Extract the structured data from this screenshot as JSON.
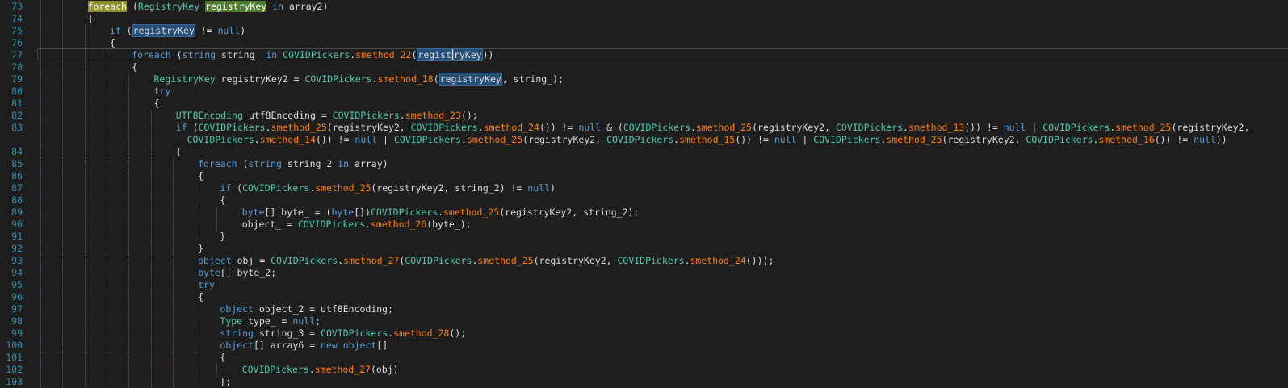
{
  "colors": {
    "background": "#1e1e1e",
    "line_number": "#2b91af",
    "keyword": "#569cd6",
    "type": "#4ec9b0",
    "method": "#ff8000",
    "text": "#dcdcdc",
    "indent_guide": "#6a4a7a"
  },
  "editor": {
    "current_line": "77",
    "lines": [
      {
        "n": "73",
        "indent": 2,
        "tokens": [
          {
            "t": "foreach",
            "c": "kw hl-yellow"
          },
          {
            "t": " (",
            "c": "tx"
          },
          {
            "t": "RegistryKey",
            "c": "ty"
          },
          {
            "t": " ",
            "c": "tx"
          },
          {
            "t": "registryKey",
            "c": "tx hl-green"
          },
          {
            "t": " ",
            "c": "tx"
          },
          {
            "t": "in",
            "c": "kw"
          },
          {
            "t": " array2)",
            "c": "tx"
          }
        ]
      },
      {
        "n": "74",
        "indent": 2,
        "tokens": [
          {
            "t": "{",
            "c": "tx"
          }
        ]
      },
      {
        "n": "75",
        "indent": 3,
        "tokens": [
          {
            "t": "if",
            "c": "kw"
          },
          {
            "t": " (",
            "c": "tx"
          },
          {
            "t": "registryKey",
            "c": "tx hl-blue"
          },
          {
            "t": " != ",
            "c": "tx"
          },
          {
            "t": "null",
            "c": "kw"
          },
          {
            "t": ")",
            "c": "tx"
          }
        ]
      },
      {
        "n": "76",
        "indent": 3,
        "tokens": [
          {
            "t": "{",
            "c": "tx"
          }
        ]
      },
      {
        "n": "77",
        "indent": 4,
        "tokens": [
          {
            "t": "foreach",
            "c": "kw"
          },
          {
            "t": " (",
            "c": "tx"
          },
          {
            "t": "string",
            "c": "kw"
          },
          {
            "t": " string_ ",
            "c": "tx"
          },
          {
            "t": "in",
            "c": "kw"
          },
          {
            "t": " ",
            "c": "tx"
          },
          {
            "t": "COVIDPickers",
            "c": "ty"
          },
          {
            "t": ".",
            "c": "tx"
          },
          {
            "t": "smethod_22",
            "c": "mt"
          },
          {
            "t": "(",
            "c": "tx"
          },
          {
            "t": "regist",
            "c": "tx hl-blue",
            "caret_after": true
          },
          {
            "t": "ryKey",
            "c": "tx hl-blue"
          },
          {
            "t": "))",
            "c": "tx"
          }
        ]
      },
      {
        "n": "78",
        "indent": 4,
        "tokens": [
          {
            "t": "{",
            "c": "tx"
          }
        ]
      },
      {
        "n": "79",
        "indent": 5,
        "tokens": [
          {
            "t": "RegistryKey",
            "c": "ty"
          },
          {
            "t": " registryKey2 = ",
            "c": "tx"
          },
          {
            "t": "COVIDPickers",
            "c": "ty"
          },
          {
            "t": ".",
            "c": "tx"
          },
          {
            "t": "smethod_18",
            "c": "mt"
          },
          {
            "t": "(",
            "c": "tx"
          },
          {
            "t": "registryKey",
            "c": "tx hl-blue"
          },
          {
            "t": ", string_);",
            "c": "tx"
          }
        ]
      },
      {
        "n": "80",
        "indent": 5,
        "tokens": [
          {
            "t": "try",
            "c": "kw"
          }
        ]
      },
      {
        "n": "81",
        "indent": 5,
        "tokens": [
          {
            "t": "{",
            "c": "tx"
          }
        ]
      },
      {
        "n": "82",
        "indent": 6,
        "tokens": [
          {
            "t": "UTF8Encoding",
            "c": "ty"
          },
          {
            "t": " utf8Encoding = ",
            "c": "tx"
          },
          {
            "t": "COVIDPickers",
            "c": "ty"
          },
          {
            "t": ".",
            "c": "tx"
          },
          {
            "t": "smethod_23",
            "c": "mt"
          },
          {
            "t": "();",
            "c": "tx"
          }
        ]
      },
      {
        "n": "83",
        "indent": 6,
        "tokens": [
          {
            "t": "if",
            "c": "kw"
          },
          {
            "t": " (",
            "c": "tx"
          },
          {
            "t": "COVIDPickers",
            "c": "ty"
          },
          {
            "t": ".",
            "c": "tx"
          },
          {
            "t": "smethod_25",
            "c": "mt"
          },
          {
            "t": "(registryKey2, ",
            "c": "tx"
          },
          {
            "t": "COVIDPickers",
            "c": "ty"
          },
          {
            "t": ".",
            "c": "tx"
          },
          {
            "t": "smethod_24",
            "c": "mt"
          },
          {
            "t": "()) != ",
            "c": "tx"
          },
          {
            "t": "null",
            "c": "kw"
          },
          {
            "t": " & (",
            "c": "tx"
          },
          {
            "t": "COVIDPickers",
            "c": "ty"
          },
          {
            "t": ".",
            "c": "tx"
          },
          {
            "t": "smethod_25",
            "c": "mt"
          },
          {
            "t": "(registryKey2, ",
            "c": "tx"
          },
          {
            "t": "COVIDPickers",
            "c": "ty"
          },
          {
            "t": ".",
            "c": "tx"
          },
          {
            "t": "smethod_13",
            "c": "mt"
          },
          {
            "t": "()) != ",
            "c": "tx"
          },
          {
            "t": "null",
            "c": "kw"
          },
          {
            "t": " | ",
            "c": "tx"
          },
          {
            "t": "COVIDPickers",
            "c": "ty"
          },
          {
            "t": ".",
            "c": "tx"
          },
          {
            "t": "smethod_25",
            "c": "mt"
          },
          {
            "t": "(registryKey2,",
            "c": "tx"
          }
        ]
      },
      {
        "n": "",
        "indent": 6,
        "wrap": true,
        "tokens": [
          {
            "t": "  ",
            "c": "tx"
          },
          {
            "t": "COVIDPickers",
            "c": "ty"
          },
          {
            "t": ".",
            "c": "tx"
          },
          {
            "t": "smethod_14",
            "c": "mt"
          },
          {
            "t": "()) != ",
            "c": "tx"
          },
          {
            "t": "null",
            "c": "kw"
          },
          {
            "t": " | ",
            "c": "tx"
          },
          {
            "t": "COVIDPickers",
            "c": "ty"
          },
          {
            "t": ".",
            "c": "tx"
          },
          {
            "t": "smethod_25",
            "c": "mt"
          },
          {
            "t": "(registryKey2, ",
            "c": "tx"
          },
          {
            "t": "COVIDPickers",
            "c": "ty"
          },
          {
            "t": ".",
            "c": "tx"
          },
          {
            "t": "smethod_15",
            "c": "mt"
          },
          {
            "t": "()) != ",
            "c": "tx"
          },
          {
            "t": "null",
            "c": "kw"
          },
          {
            "t": " | ",
            "c": "tx"
          },
          {
            "t": "COVIDPickers",
            "c": "ty"
          },
          {
            "t": ".",
            "c": "tx"
          },
          {
            "t": "smethod_25",
            "c": "mt"
          },
          {
            "t": "(registryKey2, ",
            "c": "tx"
          },
          {
            "t": "COVIDPickers",
            "c": "ty"
          },
          {
            "t": ".",
            "c": "tx"
          },
          {
            "t": "smethod_16",
            "c": "mt"
          },
          {
            "t": "()) != ",
            "c": "tx"
          },
          {
            "t": "null",
            "c": "kw"
          },
          {
            "t": "))",
            "c": "tx"
          }
        ]
      },
      {
        "n": "84",
        "indent": 6,
        "tokens": [
          {
            "t": "{",
            "c": "tx"
          }
        ]
      },
      {
        "n": "85",
        "indent": 7,
        "tokens": [
          {
            "t": "foreach",
            "c": "kw"
          },
          {
            "t": " (",
            "c": "tx"
          },
          {
            "t": "string",
            "c": "kw"
          },
          {
            "t": " string_2 ",
            "c": "tx"
          },
          {
            "t": "in",
            "c": "kw"
          },
          {
            "t": " array)",
            "c": "tx"
          }
        ]
      },
      {
        "n": "86",
        "indent": 7,
        "tokens": [
          {
            "t": "{",
            "c": "tx"
          }
        ]
      },
      {
        "n": "87",
        "indent": 8,
        "tokens": [
          {
            "t": "if",
            "c": "kw"
          },
          {
            "t": " (",
            "c": "tx"
          },
          {
            "t": "COVIDPickers",
            "c": "ty"
          },
          {
            "t": ".",
            "c": "tx"
          },
          {
            "t": "smethod_25",
            "c": "mt"
          },
          {
            "t": "(registryKey2, string_2) != ",
            "c": "tx"
          },
          {
            "t": "null",
            "c": "kw"
          },
          {
            "t": ")",
            "c": "tx"
          }
        ]
      },
      {
        "n": "88",
        "indent": 8,
        "tokens": [
          {
            "t": "{",
            "c": "tx"
          }
        ]
      },
      {
        "n": "89",
        "indent": 9,
        "tokens": [
          {
            "t": "byte",
            "c": "kw"
          },
          {
            "t": "[] byte_ = (",
            "c": "tx"
          },
          {
            "t": "byte",
            "c": "kw"
          },
          {
            "t": "[])",
            "c": "tx"
          },
          {
            "t": "COVIDPickers",
            "c": "ty"
          },
          {
            "t": ".",
            "c": "tx"
          },
          {
            "t": "smethod_25",
            "c": "mt"
          },
          {
            "t": "(registryKey2, string_2);",
            "c": "tx"
          }
        ]
      },
      {
        "n": "90",
        "indent": 9,
        "tokens": [
          {
            "t": "object_ = ",
            "c": "tx"
          },
          {
            "t": "COVIDPickers",
            "c": "ty"
          },
          {
            "t": ".",
            "c": "tx"
          },
          {
            "t": "smethod_26",
            "c": "mt"
          },
          {
            "t": "(byte_);",
            "c": "tx"
          }
        ]
      },
      {
        "n": "91",
        "indent": 8,
        "tokens": [
          {
            "t": "}",
            "c": "tx"
          }
        ]
      },
      {
        "n": "92",
        "indent": 7,
        "tokens": [
          {
            "t": "}",
            "c": "tx"
          }
        ]
      },
      {
        "n": "93",
        "indent": 7,
        "tokens": [
          {
            "t": "object",
            "c": "kw"
          },
          {
            "t": " obj = ",
            "c": "tx"
          },
          {
            "t": "COVIDPickers",
            "c": "ty"
          },
          {
            "t": ".",
            "c": "tx"
          },
          {
            "t": "smethod_27",
            "c": "mt"
          },
          {
            "t": "(",
            "c": "tx"
          },
          {
            "t": "COVIDPickers",
            "c": "ty"
          },
          {
            "t": ".",
            "c": "tx"
          },
          {
            "t": "smethod_25",
            "c": "mt"
          },
          {
            "t": "(registryKey2, ",
            "c": "tx"
          },
          {
            "t": "COVIDPickers",
            "c": "ty"
          },
          {
            "t": ".",
            "c": "tx"
          },
          {
            "t": "smethod_24",
            "c": "mt"
          },
          {
            "t": "()));",
            "c": "tx"
          }
        ]
      },
      {
        "n": "94",
        "indent": 7,
        "tokens": [
          {
            "t": "byte",
            "c": "kw"
          },
          {
            "t": "[] byte_2;",
            "c": "tx"
          }
        ]
      },
      {
        "n": "95",
        "indent": 7,
        "tokens": [
          {
            "t": "try",
            "c": "kw"
          }
        ]
      },
      {
        "n": "96",
        "indent": 7,
        "tokens": [
          {
            "t": "{",
            "c": "tx"
          }
        ]
      },
      {
        "n": "97",
        "indent": 8,
        "tokens": [
          {
            "t": "object",
            "c": "kw"
          },
          {
            "t": " object_2 = utf8Encoding;",
            "c": "tx"
          }
        ]
      },
      {
        "n": "98",
        "indent": 8,
        "tokens": [
          {
            "t": "Type",
            "c": "ty"
          },
          {
            "t": " type_ = ",
            "c": "tx"
          },
          {
            "t": "null",
            "c": "kw"
          },
          {
            "t": ";",
            "c": "tx"
          }
        ]
      },
      {
        "n": "99",
        "indent": 8,
        "tokens": [
          {
            "t": "string",
            "c": "kw"
          },
          {
            "t": " string_3 = ",
            "c": "tx"
          },
          {
            "t": "COVIDPickers",
            "c": "ty"
          },
          {
            "t": ".",
            "c": "tx"
          },
          {
            "t": "smethod_28",
            "c": "mt"
          },
          {
            "t": "();",
            "c": "tx"
          }
        ]
      },
      {
        "n": "100",
        "indent": 8,
        "tokens": [
          {
            "t": "object",
            "c": "kw"
          },
          {
            "t": "[] array6 = ",
            "c": "tx"
          },
          {
            "t": "new",
            "c": "kw"
          },
          {
            "t": " ",
            "c": "tx"
          },
          {
            "t": "object",
            "c": "kw"
          },
          {
            "t": "[]",
            "c": "tx"
          }
        ]
      },
      {
        "n": "101",
        "indent": 8,
        "tokens": [
          {
            "t": "{",
            "c": "tx"
          }
        ]
      },
      {
        "n": "102",
        "indent": 9,
        "tokens": [
          {
            "t": "COVIDPickers",
            "c": "ty"
          },
          {
            "t": ".",
            "c": "tx"
          },
          {
            "t": "smethod_27",
            "c": "mt"
          },
          {
            "t": "(obj)",
            "c": "tx"
          }
        ]
      },
      {
        "n": "103",
        "indent": 8,
        "tokens": [
          {
            "t": "};",
            "c": "tx"
          }
        ]
      }
    ]
  }
}
